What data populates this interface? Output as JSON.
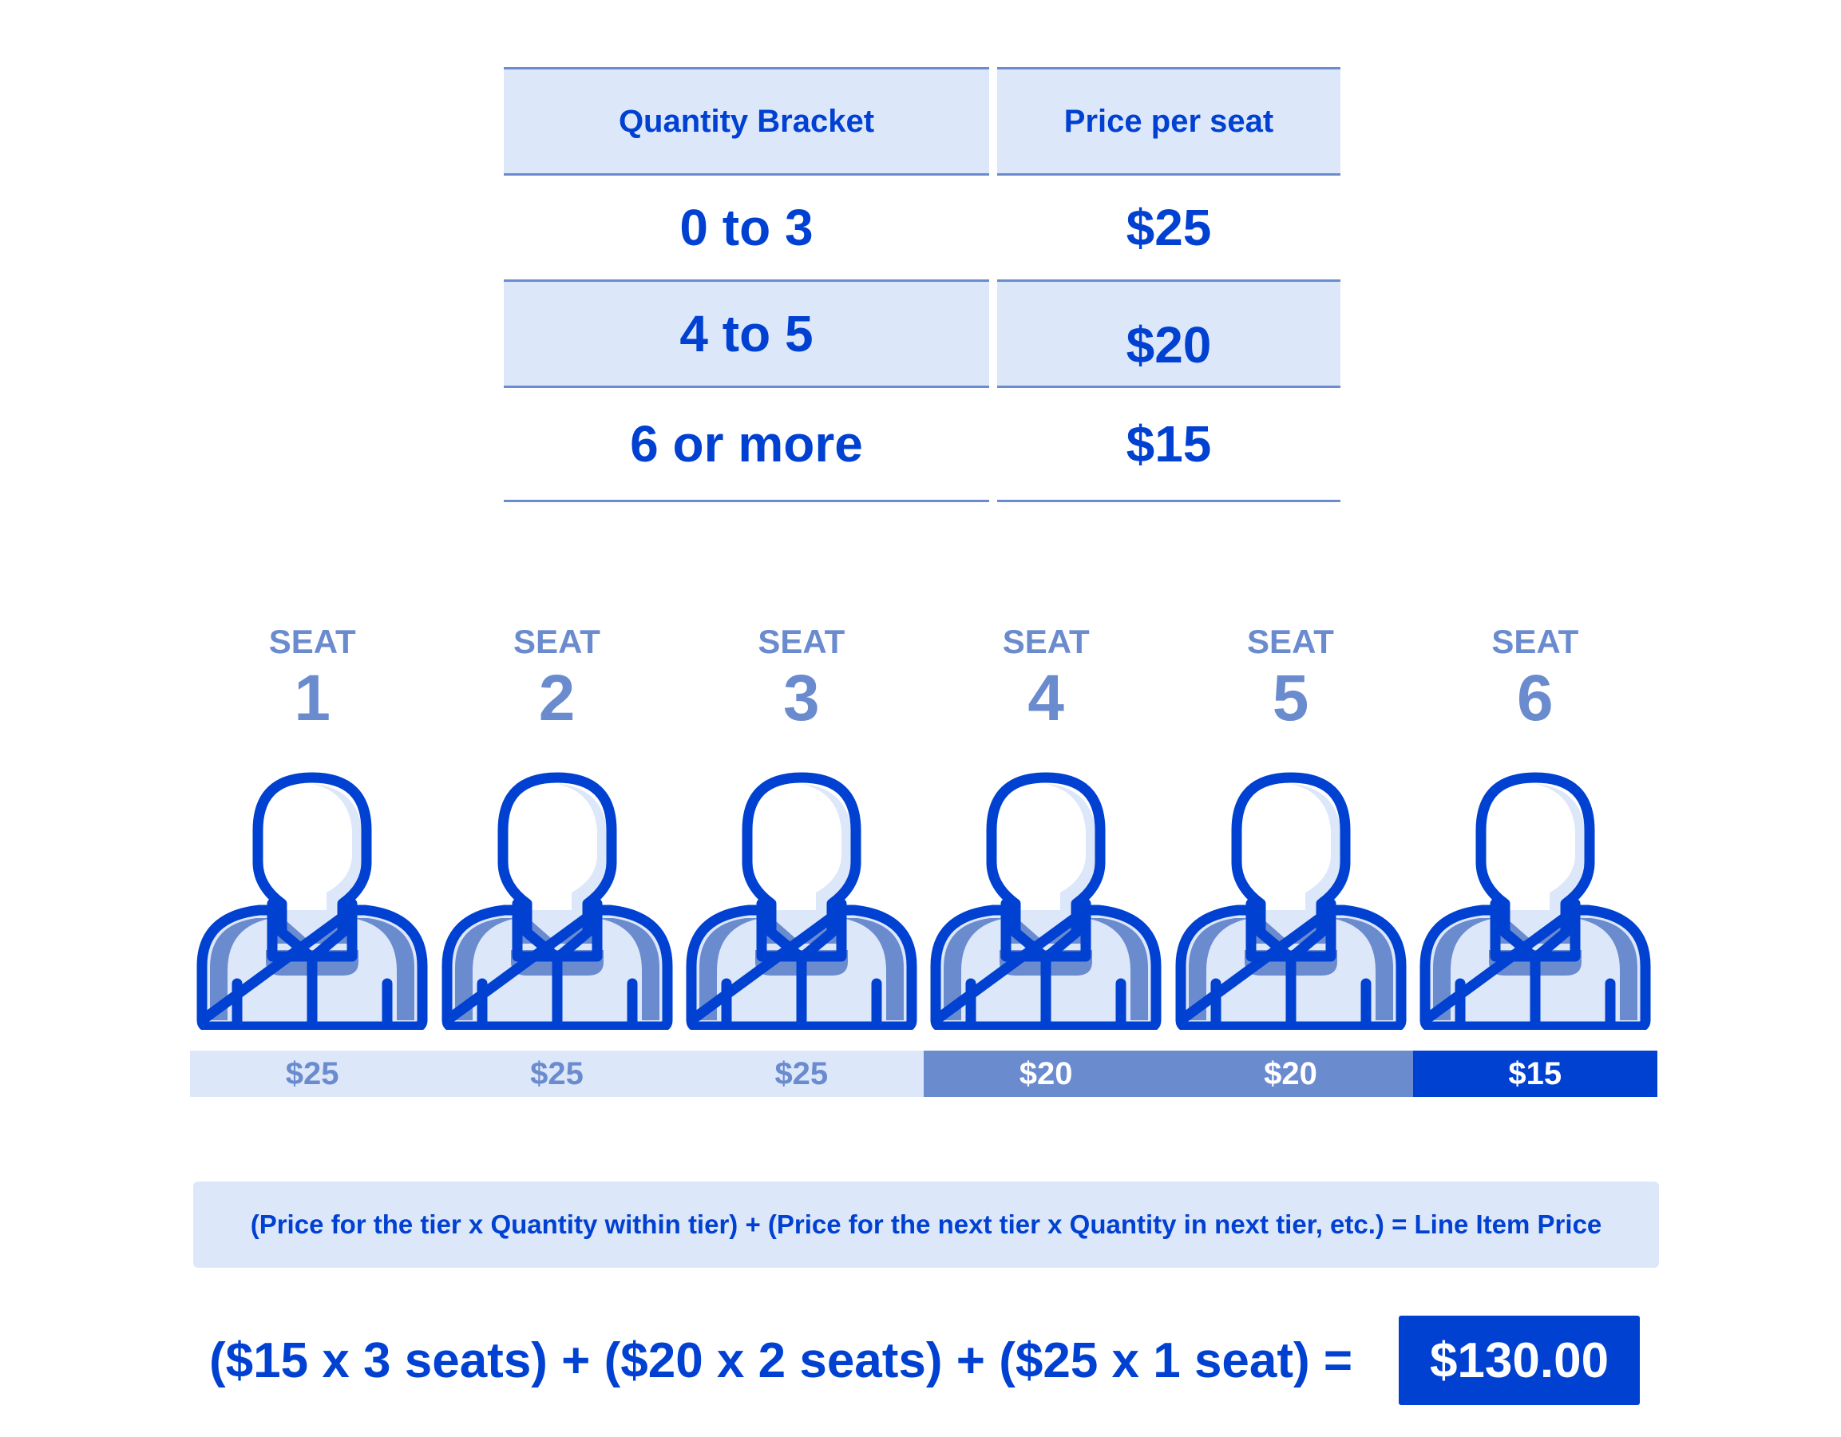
{
  "colors": {
    "primary": "#0041d2",
    "medium": "#6b8bcf",
    "light": "#dde7fa",
    "white": "#ffffff"
  },
  "table": {
    "headers": [
      "Quantity Bracket",
      "Price per seat"
    ],
    "rows": [
      {
        "bracket": "0 to 3",
        "price": "$25"
      },
      {
        "bracket": "4 to 5",
        "price": "$20"
      },
      {
        "bracket": "6 or more",
        "price": "$15"
      }
    ]
  },
  "seats": [
    {
      "label": "SEAT",
      "number": "1",
      "price": "$25",
      "tier": "light"
    },
    {
      "label": "SEAT",
      "number": "2",
      "price": "$25",
      "tier": "light"
    },
    {
      "label": "SEAT",
      "number": "3",
      "price": "$25",
      "tier": "light"
    },
    {
      "label": "SEAT",
      "number": "4",
      "price": "$20",
      "tier": "medium"
    },
    {
      "label": "SEAT",
      "number": "5",
      "price": "$20",
      "tier": "medium"
    },
    {
      "label": "SEAT",
      "number": "6",
      "price": "$15",
      "tier": "primary"
    }
  ],
  "formula": "(Price for the tier x Quantity within tier) + (Price for the next tier x Quantity in next tier, etc.) = Line Item Price",
  "equation": {
    "expression": "($15 x 3 seats) + ($20 x 2 seats) + ($25 x 1 seat) =",
    "total": "$130.00"
  }
}
